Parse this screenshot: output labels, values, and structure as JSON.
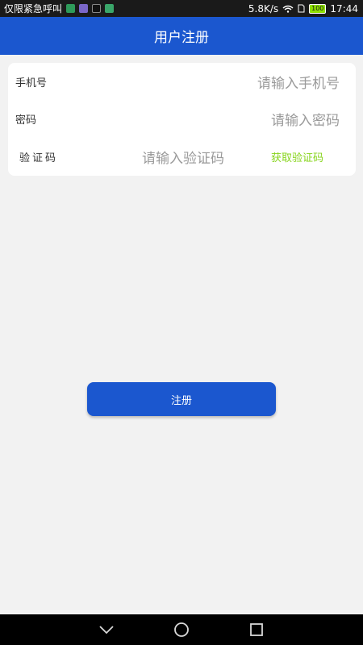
{
  "status_bar": {
    "carrier_text": "仅限紧急呼叫",
    "net_speed": "5.8K/s",
    "battery": "100",
    "time": "17:44",
    "notification_icons": [
      "sms-icon",
      "app-icon",
      "tc-icon",
      "message-icon"
    ]
  },
  "header": {
    "title": "用户注册"
  },
  "form": {
    "phone": {
      "label": "手机号",
      "placeholder": "请输入手机号"
    },
    "password": {
      "label": "密码",
      "placeholder": "请输入密码"
    },
    "code": {
      "label": "验证码",
      "placeholder": "请输入验证码",
      "action": "获取验证码"
    }
  },
  "register_label": "注册",
  "colors": {
    "primary": "#1b57cf",
    "accent_green": "#86d41a",
    "background": "#f2f2f2"
  }
}
